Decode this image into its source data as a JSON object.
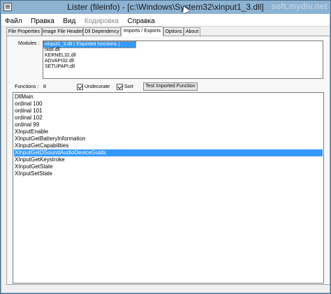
{
  "window": {
    "title": "Lister (fileinfo) - [c:\\Windows\\System32\\xinput1_3.dll]",
    "watermark": "soft.mydiv.net"
  },
  "menu": [
    {
      "label": "Файл",
      "enabled": true
    },
    {
      "label": "Правка",
      "enabled": true
    },
    {
      "label": "Вид",
      "enabled": true
    },
    {
      "label": "Кодировка",
      "enabled": false
    },
    {
      "label": "Справка",
      "enabled": true
    }
  ],
  "tabs": [
    {
      "label": "File Properties",
      "active": false
    },
    {
      "label": "Image File Header",
      "active": false
    },
    {
      "label": "Dll Dependency",
      "active": false
    },
    {
      "label": "Imports / Exports",
      "active": true
    },
    {
      "label": "Options",
      "active": false
    },
    {
      "label": "About",
      "active": false
    }
  ],
  "modules": {
    "label": "Modules :",
    "items": [
      "xinput1_3.dll  ( Exported functions )",
      "ntdll.dll",
      "KERNEL32.dll",
      "ADVAPI32.dll",
      "SETUPAPI.dll"
    ],
    "selected_index": 0
  },
  "functions": {
    "label": "Functions :",
    "count": "8",
    "undecorate_label": "Undecorate",
    "undecorate_checked": true,
    "sort_label": "Sort",
    "sort_checked": true,
    "test_button": "Test Imported Function",
    "items": [
      "DllMain",
      "ordinal 100",
      "ordinal 101",
      "ordinal 102",
      "ordinal 99",
      "XInputEnable",
      "XInputGetBatteryInformation",
      "XInputGetCapabilities",
      "XInputGetDSoundAudioDeviceGuids",
      "XInputGetKeystroke",
      "XInputGetState",
      "XInputSetState"
    ],
    "selected_index": 8
  },
  "colors": {
    "selection": "#3399ff",
    "titlebar": "#8db3d3"
  }
}
